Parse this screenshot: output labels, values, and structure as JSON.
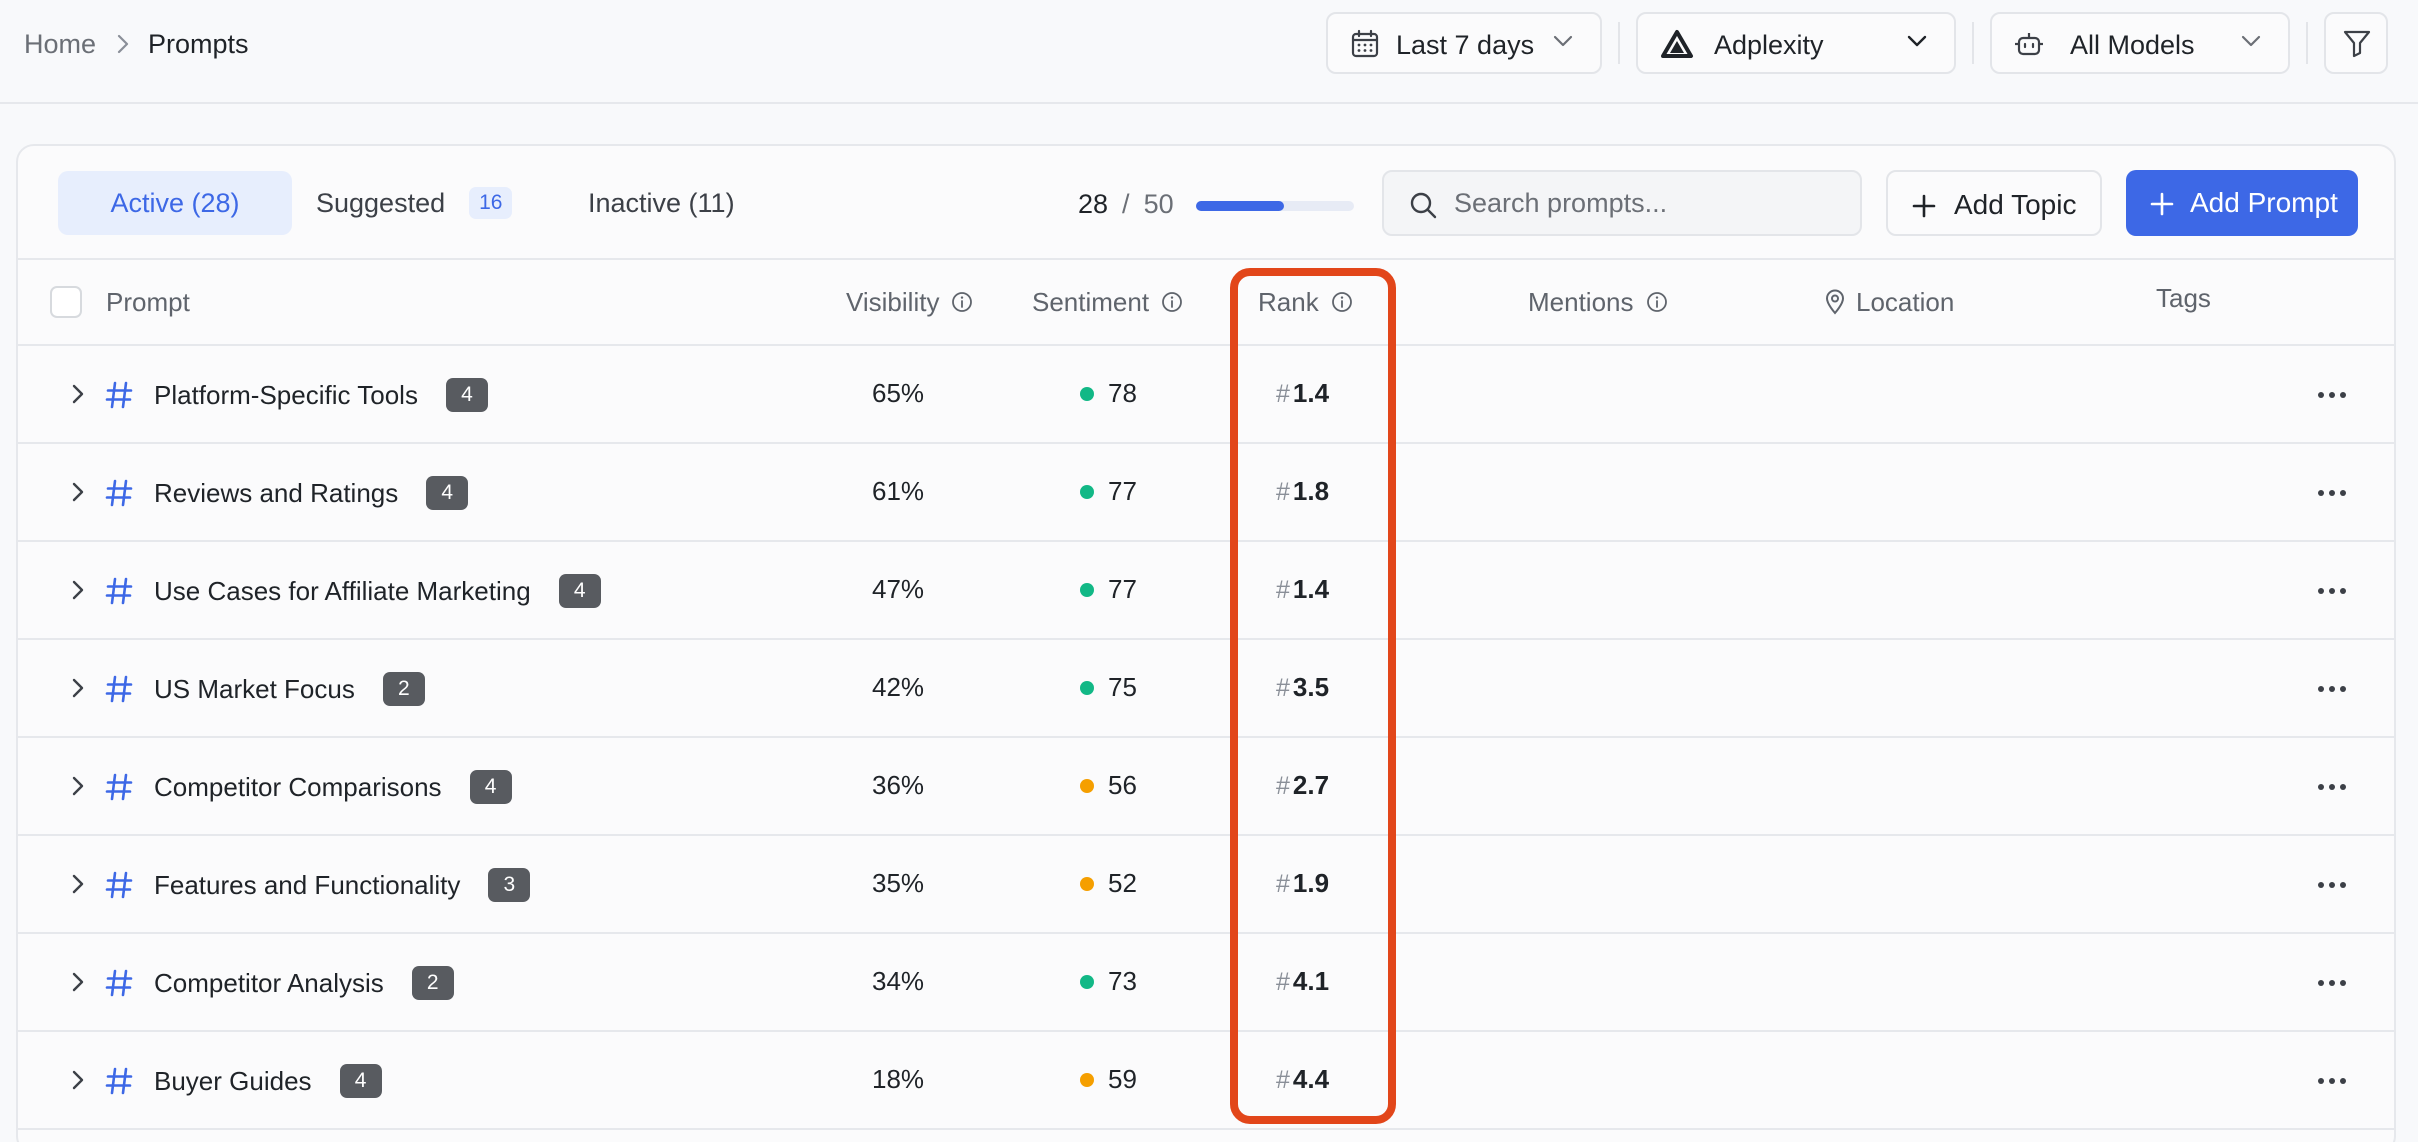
{
  "breadcrumb": {
    "home": "Home",
    "current": "Prompts"
  },
  "filters": {
    "date_range": "Last 7 days",
    "brand": "Adplexity",
    "models": "All Models"
  },
  "tabs": {
    "active": "Active (28)",
    "suggested": "Suggested",
    "suggested_count": "16",
    "inactive": "Inactive (11)"
  },
  "usage": {
    "used": "28",
    "separator": "/",
    "limit": "50",
    "fraction": 0.56
  },
  "search": {
    "placeholder": "Search prompts...",
    "value": ""
  },
  "actions": {
    "add_topic": "Add Topic",
    "add_prompt": "Add Prompt"
  },
  "columns": {
    "prompt": "Prompt",
    "visibility": "Visibility",
    "sentiment": "Sentiment",
    "rank": "Rank",
    "mentions": "Mentions",
    "location": "Location",
    "tags": "Tags"
  },
  "rank_prefix": "#",
  "colors": {
    "accent": "#3d68e6",
    "positive": "#12b886",
    "neutral": "#f59f00",
    "highlight": "#e2461a"
  },
  "rows": [
    {
      "name": "Platform-Specific Tools",
      "count": "4",
      "visibility": "65%",
      "sentiment": "78",
      "sentiment_status": "positive",
      "rank": "1.4"
    },
    {
      "name": "Reviews and Ratings",
      "count": "4",
      "visibility": "61%",
      "sentiment": "77",
      "sentiment_status": "positive",
      "rank": "1.8"
    },
    {
      "name": "Use Cases for Affiliate Marketing",
      "count": "4",
      "visibility": "47%",
      "sentiment": "77",
      "sentiment_status": "positive",
      "rank": "1.4"
    },
    {
      "name": "US Market Focus",
      "count": "2",
      "visibility": "42%",
      "sentiment": "75",
      "sentiment_status": "positive",
      "rank": "3.5"
    },
    {
      "name": "Competitor Comparisons",
      "count": "4",
      "visibility": "36%",
      "sentiment": "56",
      "sentiment_status": "neutral",
      "rank": "2.7"
    },
    {
      "name": "Features and Functionality",
      "count": "3",
      "visibility": "35%",
      "sentiment": "52",
      "sentiment_status": "neutral",
      "rank": "1.9"
    },
    {
      "name": "Competitor Analysis",
      "count": "2",
      "visibility": "34%",
      "sentiment": "73",
      "sentiment_status": "positive",
      "rank": "4.1"
    },
    {
      "name": "Buyer Guides",
      "count": "4",
      "visibility": "18%",
      "sentiment": "59",
      "sentiment_status": "neutral",
      "rank": "4.4"
    }
  ]
}
